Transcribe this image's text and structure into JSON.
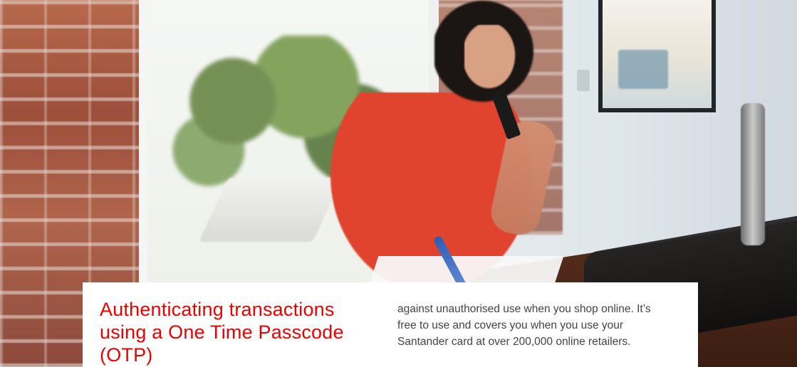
{
  "card": {
    "title": "Authenticating transactions using a One Time Passcode (OTP)",
    "body": "against unauthorised use when you shop online. It’s free to use and covers you when you use your Santander card at over 200,000 online retailers."
  },
  "colors": {
    "title_red": "#ec0000",
    "text_gray": "#444444",
    "card_bg": "#ffffff"
  }
}
